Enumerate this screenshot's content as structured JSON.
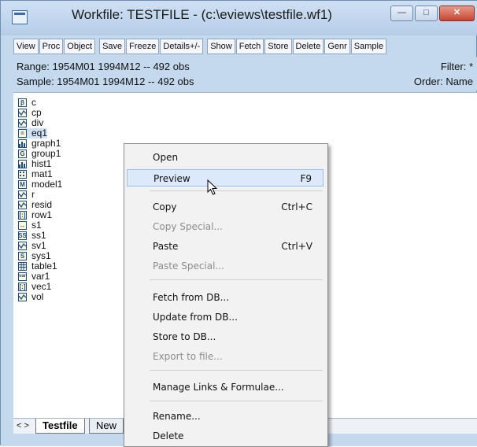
{
  "window": {
    "title": "Workfile: TESTFILE - (c:\\eviews\\testfile.wf1)",
    "controls": {
      "minimize": "—",
      "maximize": "□",
      "close": "✕"
    }
  },
  "toolbar": [
    "View",
    "Proc",
    "Object",
    "Save",
    "Freeze",
    "Details+/-",
    "Show",
    "Fetch",
    "Store",
    "Delete",
    "Genr",
    "Sample"
  ],
  "info": {
    "range": "Range:  1954M01 1994M12  --  492 obs",
    "filter": "Filter: *",
    "sample": "Sample: 1954M01 1994M12  --  492 obs",
    "order": "Order: Name"
  },
  "objects": [
    {
      "name": "c",
      "icon": "coef-icon"
    },
    {
      "name": "cp",
      "icon": "series-icon"
    },
    {
      "name": "div",
      "icon": "series-icon"
    },
    {
      "name": "eq1",
      "icon": "equation-icon"
    },
    {
      "name": "graph1",
      "icon": "graph-icon"
    },
    {
      "name": "group1",
      "icon": "group-icon"
    },
    {
      "name": "hist1",
      "icon": "graph-icon"
    },
    {
      "name": "mat1",
      "icon": "matrix-icon"
    },
    {
      "name": "model1",
      "icon": "model-icon"
    },
    {
      "name": "r",
      "icon": "series-icon"
    },
    {
      "name": "resid",
      "icon": "series-icon"
    },
    {
      "name": "row1",
      "icon": "rowvector-icon"
    },
    {
      "name": "s1",
      "icon": "sample-icon"
    },
    {
      "name": "ss1",
      "icon": "sspace-icon"
    },
    {
      "name": "sv1",
      "icon": "series-icon"
    },
    {
      "name": "sys1",
      "icon": "system-icon"
    },
    {
      "name": "table1",
      "icon": "table-icon"
    },
    {
      "name": "var1",
      "icon": "var-icon"
    },
    {
      "name": "vec1",
      "icon": "vector-icon"
    },
    {
      "name": "vol",
      "icon": "series-icon"
    }
  ],
  "icon_glyphs": {
    "coef": "β",
    "equation": "=",
    "group": "G",
    "model": "M",
    "sspace": "SS",
    "system": "S",
    "var": "var",
    "vector": "[:]",
    "rowvector": "[:]",
    "sample": "↔"
  },
  "tabs": {
    "active": "Testfile",
    "other": "New",
    "nav": "< >"
  },
  "context_menu": {
    "items": [
      {
        "label": "Open",
        "shortcut": "",
        "disabled": false
      },
      {
        "label": "Preview",
        "shortcut": "F9",
        "disabled": false
      },
      {
        "label": "Copy",
        "shortcut": "Ctrl+C",
        "disabled": false
      },
      {
        "label": "Copy Special...",
        "shortcut": "",
        "disabled": true
      },
      {
        "label": "Paste",
        "shortcut": "Ctrl+V",
        "disabled": false
      },
      {
        "label": "Paste Special...",
        "shortcut": "",
        "disabled": true
      },
      {
        "label": "Fetch from DB...",
        "shortcut": "",
        "disabled": false
      },
      {
        "label": "Update from DB...",
        "shortcut": "",
        "disabled": false
      },
      {
        "label": "Store to DB...",
        "shortcut": "",
        "disabled": false
      },
      {
        "label": "Export to file...",
        "shortcut": "",
        "disabled": true
      },
      {
        "label": "Manage Links & Formulae...",
        "shortcut": "",
        "disabled": false
      },
      {
        "label": "Rename...",
        "shortcut": "",
        "disabled": false
      },
      {
        "label": "Delete",
        "shortcut": "",
        "disabled": false
      }
    ]
  },
  "colors": {
    "chrome": "#c4d8ee",
    "accent": "#1b4b8a",
    "icon_fill": "#fff9d6",
    "menu_hover": "#dbe9fa"
  }
}
